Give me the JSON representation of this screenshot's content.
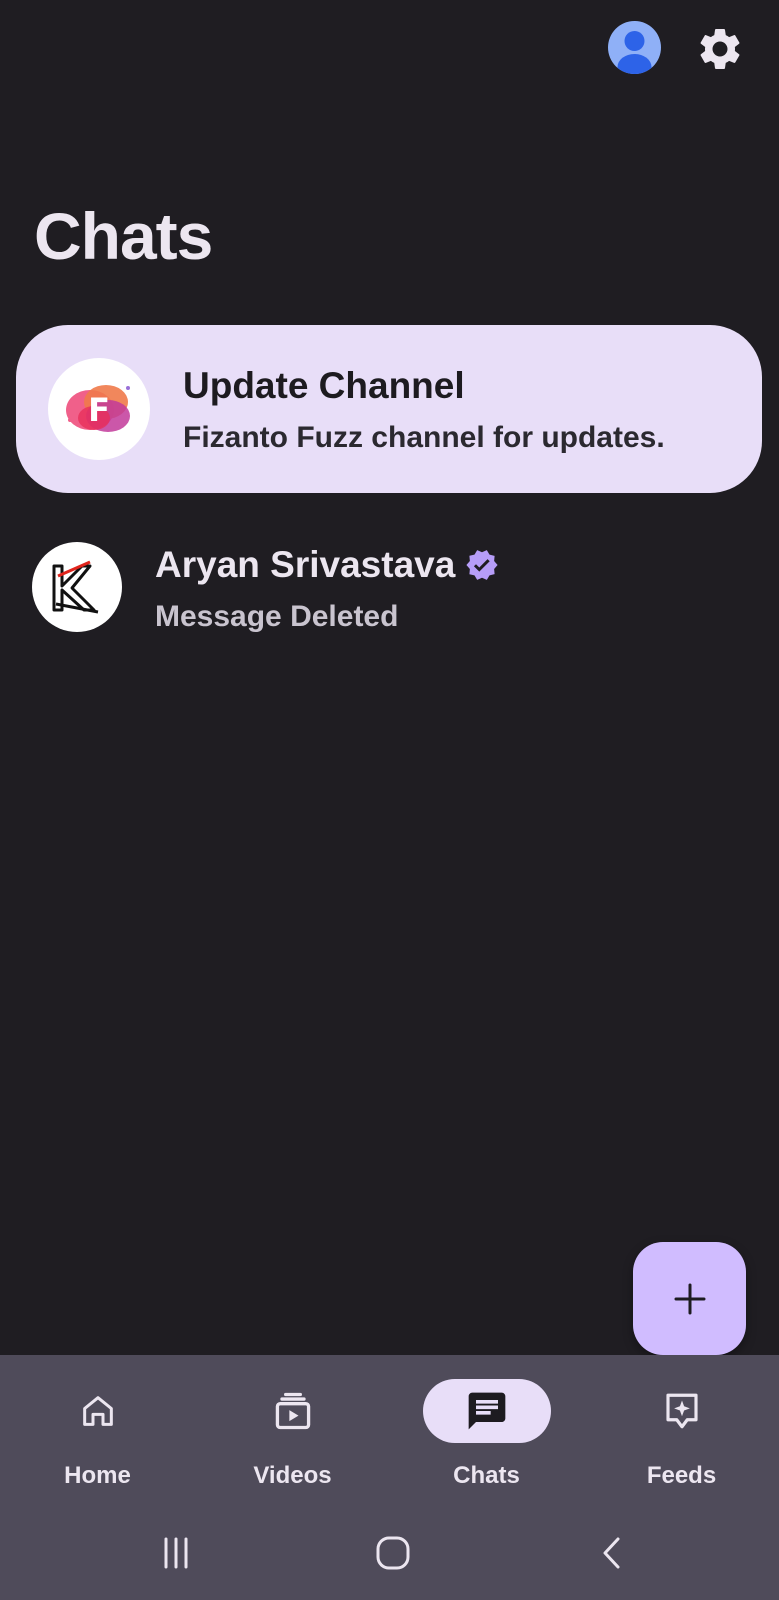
{
  "header": {
    "title": "Chats",
    "profile_icon": "account-circle-icon",
    "settings_icon": "gear-icon"
  },
  "update_channel": {
    "title": "Update Channel",
    "subtitle": "Fizanto Fuzz channel for updates.",
    "logo_letter": "F"
  },
  "chats": [
    {
      "name": "Aryan Srivastava",
      "verified": true,
      "last_message": "Message Deleted"
    }
  ],
  "fab": {
    "icon": "plus-icon"
  },
  "bottom_nav": {
    "items": [
      {
        "label": "Home",
        "icon": "home-icon",
        "active": false
      },
      {
        "label": "Videos",
        "icon": "video-library-icon",
        "active": false
      },
      {
        "label": "Chats",
        "icon": "chat-icon",
        "active": true
      },
      {
        "label": "Feeds",
        "icon": "feeds-sparkle-icon",
        "active": false
      }
    ]
  },
  "system_nav": [
    "recents-icon",
    "home-circle-icon",
    "back-icon"
  ],
  "colors": {
    "background": "#1f1d22",
    "card": "#e8def8",
    "accent": "#d0bcff",
    "nav_bg": "#4f4b5a",
    "verified": "#b69df8"
  }
}
